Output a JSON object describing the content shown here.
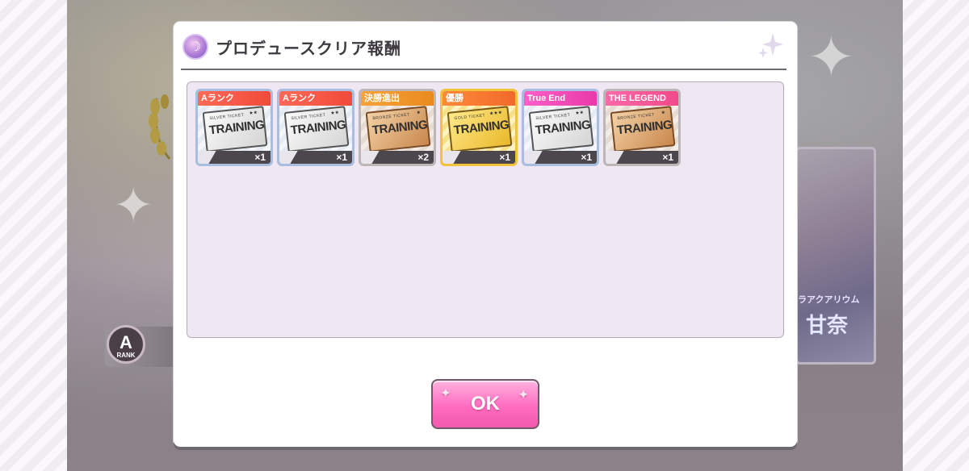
{
  "dialog": {
    "title": "プロデュースクリア報酬",
    "ok_label": "OK"
  },
  "rewards": [
    {
      "badge": "Aランク",
      "ticket_sub": "SILVER TICKET",
      "ticket_main": "TRAINING",
      "quantity": "×1",
      "tier": "silver",
      "badge_color": "#f04a3a"
    },
    {
      "badge": "Aランク",
      "ticket_sub": "SILVER TICKET",
      "ticket_main": "TRAINING",
      "quantity": "×1",
      "tier": "silver",
      "badge_color": "#f04a3a"
    },
    {
      "badge": "決勝進出",
      "ticket_sub": "BRONZE TICKET",
      "ticket_main": "TRAINING",
      "quantity": "×2",
      "tier": "bronze",
      "badge_color": "#e98a1e"
    },
    {
      "badge": "優勝",
      "ticket_sub": "GOLD TICKET",
      "ticket_main": "TRAINING",
      "quantity": "×1",
      "tier": "gold",
      "badge_color": "#f06a2a"
    },
    {
      "badge": "True End",
      "ticket_sub": "SILVER TICKET",
      "ticket_main": "TRAINING",
      "quantity": "×1",
      "tier": "silver",
      "badge_color": "#e83aa8"
    },
    {
      "badge": "THE LEGEND",
      "ticket_sub": "BRONZE TICKET",
      "ticket_main": "TRAINING",
      "quantity": "×1",
      "tier": "bronze",
      "badge_color": "#f04a8a"
    }
  ],
  "background": {
    "rank_letter": "A",
    "rank_label": "RANK",
    "card_caption_1": "ラアクアリウム",
    "card_caption_2": "甘奈"
  }
}
